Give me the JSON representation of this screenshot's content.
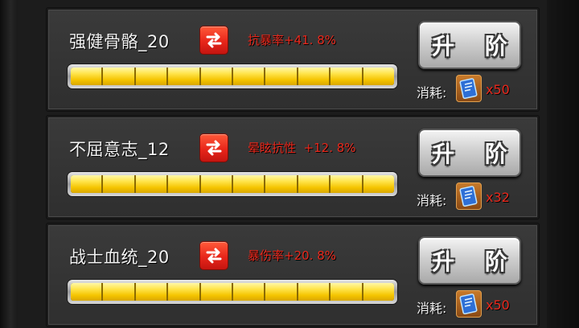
{
  "upgrade_label": "升 阶",
  "cost_label": "消耗:",
  "skills": [
    {
      "name": "强健骨骼_20",
      "stat": "抗暴率+41. 8%",
      "progress": 1.0,
      "cost_qty": "x50",
      "cost_icon": "crystal-book-icon"
    },
    {
      "name": "不屈意志_12",
      "stat": "晕眩抗性  +12. 8%",
      "progress": 1.0,
      "cost_qty": "x32",
      "cost_icon": "crystal-book-icon"
    },
    {
      "name": "战士血统_20",
      "stat": "暴伤率+20. 8%",
      "progress": 1.0,
      "cost_qty": "x50",
      "cost_icon": "crystal-book-icon"
    }
  ],
  "colors": {
    "stat_text": "#e8281c",
    "swap_button": "#e8261a",
    "progress_fill": "#f5c400"
  }
}
